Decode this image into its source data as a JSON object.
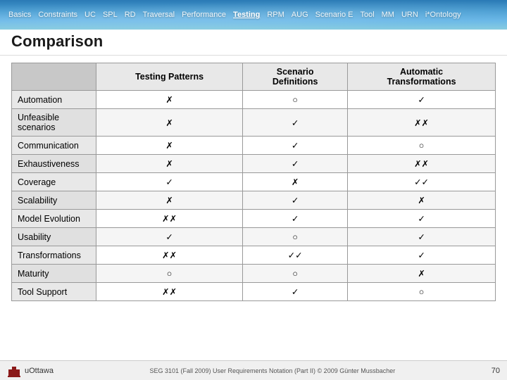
{
  "nav": {
    "items": [
      {
        "label": "Basics",
        "active": false
      },
      {
        "label": "Constraints",
        "active": false
      },
      {
        "label": "UC",
        "active": false
      },
      {
        "label": "SPL",
        "active": false
      },
      {
        "label": "RD",
        "active": false
      },
      {
        "label": "Traversal",
        "active": false
      },
      {
        "label": "Performance",
        "active": false
      },
      {
        "label": "Testing",
        "active": true
      },
      {
        "label": "RPM",
        "active": false
      },
      {
        "label": "AUG",
        "active": false
      },
      {
        "label": "Scenario E",
        "active": false
      },
      {
        "label": "Tool",
        "active": false
      },
      {
        "label": "MM",
        "active": false
      },
      {
        "label": "URN",
        "active": false
      },
      {
        "label": "i*Ontology",
        "active": false
      }
    ]
  },
  "page": {
    "title": "Comparison"
  },
  "table": {
    "columns": [
      "",
      "Testing Patterns",
      "Scenario\nDefinitions",
      "Automatic\nTransformations"
    ],
    "rows": [
      {
        "label": "Automation",
        "testing_patterns": "✗",
        "scenario_definitions": "○",
        "automatic_transformations": "✓"
      },
      {
        "label": "Unfeasible\nscenarios",
        "testing_patterns": "✗",
        "scenario_definitions": "✓",
        "automatic_transformations": "✗✗"
      },
      {
        "label": "Communication",
        "testing_patterns": "✗",
        "scenario_definitions": "✓",
        "automatic_transformations": "○"
      },
      {
        "label": "Exhaustiveness",
        "testing_patterns": "✗",
        "scenario_definitions": "✓",
        "automatic_transformations": "✗✗"
      },
      {
        "label": "Coverage",
        "testing_patterns": "✓",
        "scenario_definitions": "✗",
        "automatic_transformations": "✓✓"
      },
      {
        "label": "Scalability",
        "testing_patterns": "✗",
        "scenario_definitions": "✓",
        "automatic_transformations": "✗"
      },
      {
        "label": "Model Evolution",
        "testing_patterns": "✗✗",
        "scenario_definitions": "✓",
        "automatic_transformations": "✓"
      },
      {
        "label": "Usability",
        "testing_patterns": "✓",
        "scenario_definitions": "○",
        "automatic_transformations": "✓"
      },
      {
        "label": "Transformations",
        "testing_patterns": "✗✗",
        "scenario_definitions": "✓✓",
        "automatic_transformations": "✓"
      },
      {
        "label": "Maturity",
        "testing_patterns": "○",
        "scenario_definitions": "○",
        "automatic_transformations": "✗"
      },
      {
        "label": "Tool Support",
        "testing_patterns": "✗✗",
        "scenario_definitions": "✓",
        "automatic_transformations": "○"
      }
    ]
  },
  "footer": {
    "logo_text": "uOttawa",
    "page_number": "70",
    "copyright_text": "SEG 3101 (Fall 2009)   User Requirements Notation (Part II)   © 2009 Günter Mussbacher"
  }
}
